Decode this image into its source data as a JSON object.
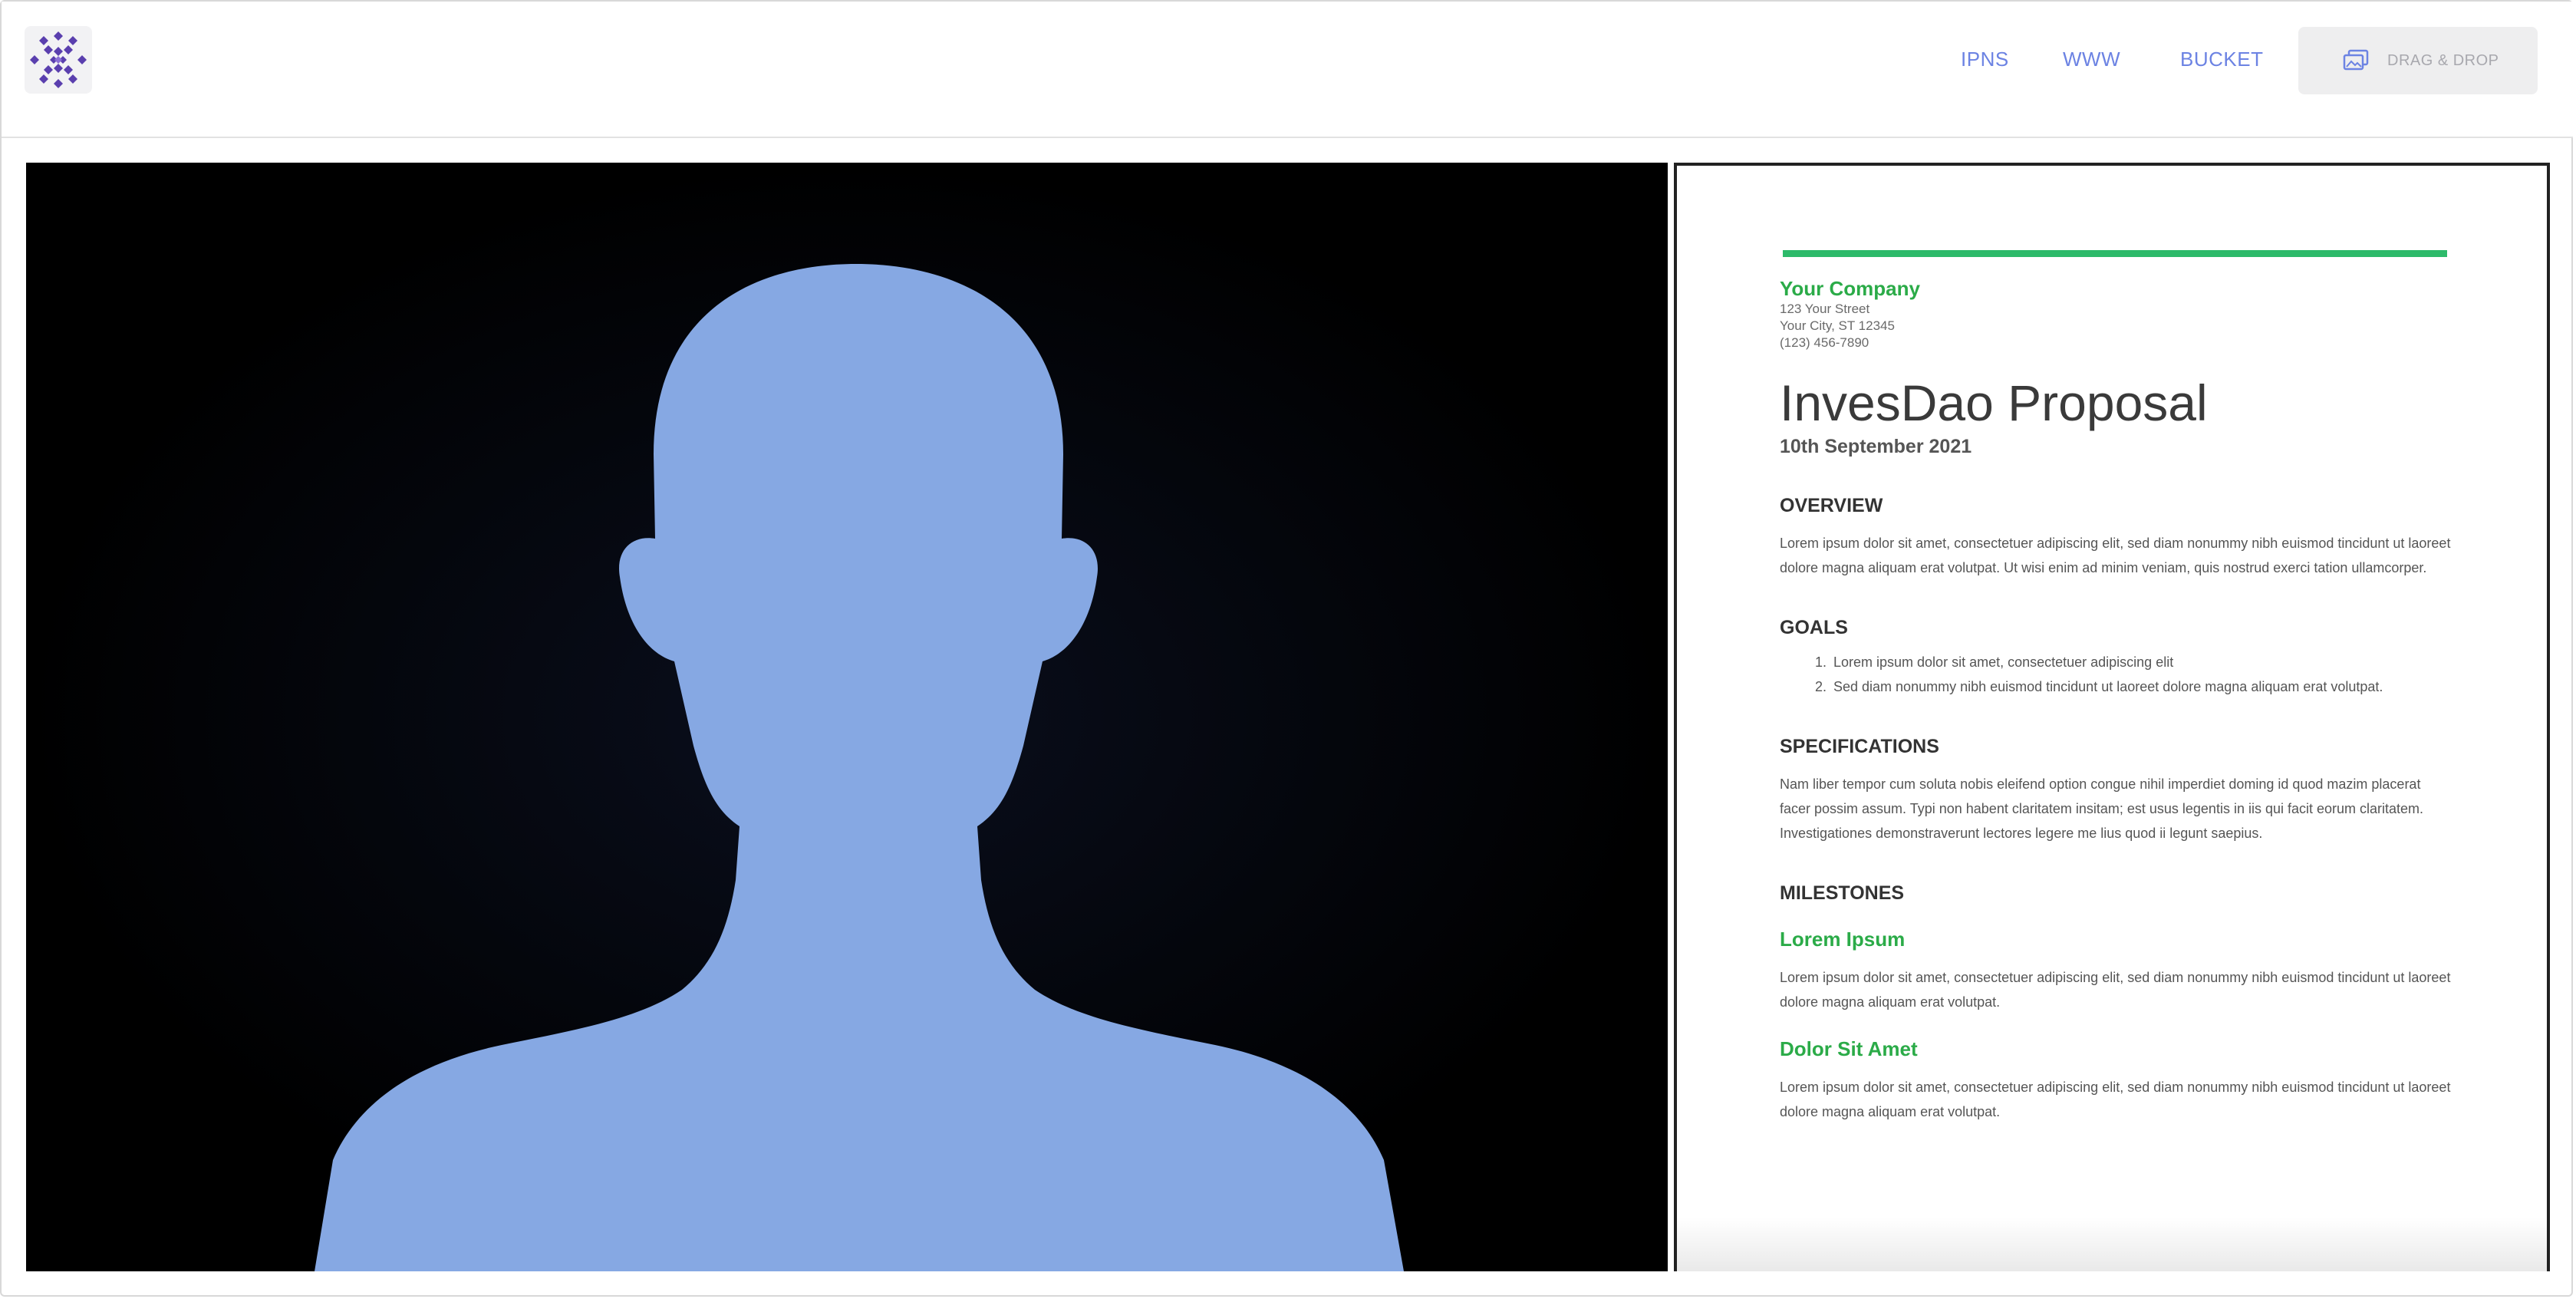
{
  "header": {
    "nav": [
      {
        "label": "IPNS"
      },
      {
        "label": "WWW"
      },
      {
        "label": "BUCKET"
      }
    ],
    "drag_drop_label": "DRAG & DROP",
    "accent_color": "#6c83e3"
  },
  "preview": {
    "image_subject": "person-silhouette",
    "silhouette_color": "#86a8e3"
  },
  "document": {
    "company": "Your Company",
    "address_lines": [
      "123 Your Street",
      "Your City, ST 12345",
      "(123) 456-7890"
    ],
    "title": "InvesDao Proposal",
    "date": "10th September 2021",
    "overview_heading": "OVERVIEW",
    "overview_text": "Lorem ipsum dolor sit amet, consectetuer adipiscing elit, sed diam nonummy nibh euismod tincidunt ut laoreet dolore magna aliquam erat volutpat. Ut wisi enim ad minim veniam, quis nostrud exerci tation ullamcorper.",
    "goals_heading": "GOALS",
    "goals": [
      "Lorem ipsum dolor sit amet, consectetuer adipiscing elit",
      "Sed diam nonummy nibh euismod tincidunt ut laoreet dolore magna aliquam erat volutpat."
    ],
    "specs_heading": "SPECIFICATIONS",
    "specs_text": "Nam liber tempor cum soluta nobis eleifend option congue nihil imperdiet doming id quod mazim placerat facer possim assum. Typi non habent claritatem insitam; est usus legentis in iis qui facit eorum claritatem. Investigationes demonstraverunt lectores legere me lius quod ii legunt saepius.",
    "milestones_heading": "MILESTONES",
    "milestones": [
      {
        "title": "Lorem Ipsum",
        "text": "Lorem ipsum dolor sit amet, consectetuer adipiscing elit, sed diam nonummy nibh euismod tincidunt ut laoreet dolore magna aliquam erat volutpat."
      },
      {
        "title": "Dolor Sit Amet",
        "text": "Lorem ipsum dolor sit amet, consectetuer adipiscing elit, sed diam nonummy nibh euismod tincidunt ut laoreet dolore magna aliquam erat volutpat."
      }
    ],
    "accent_color": "#2bab48"
  }
}
